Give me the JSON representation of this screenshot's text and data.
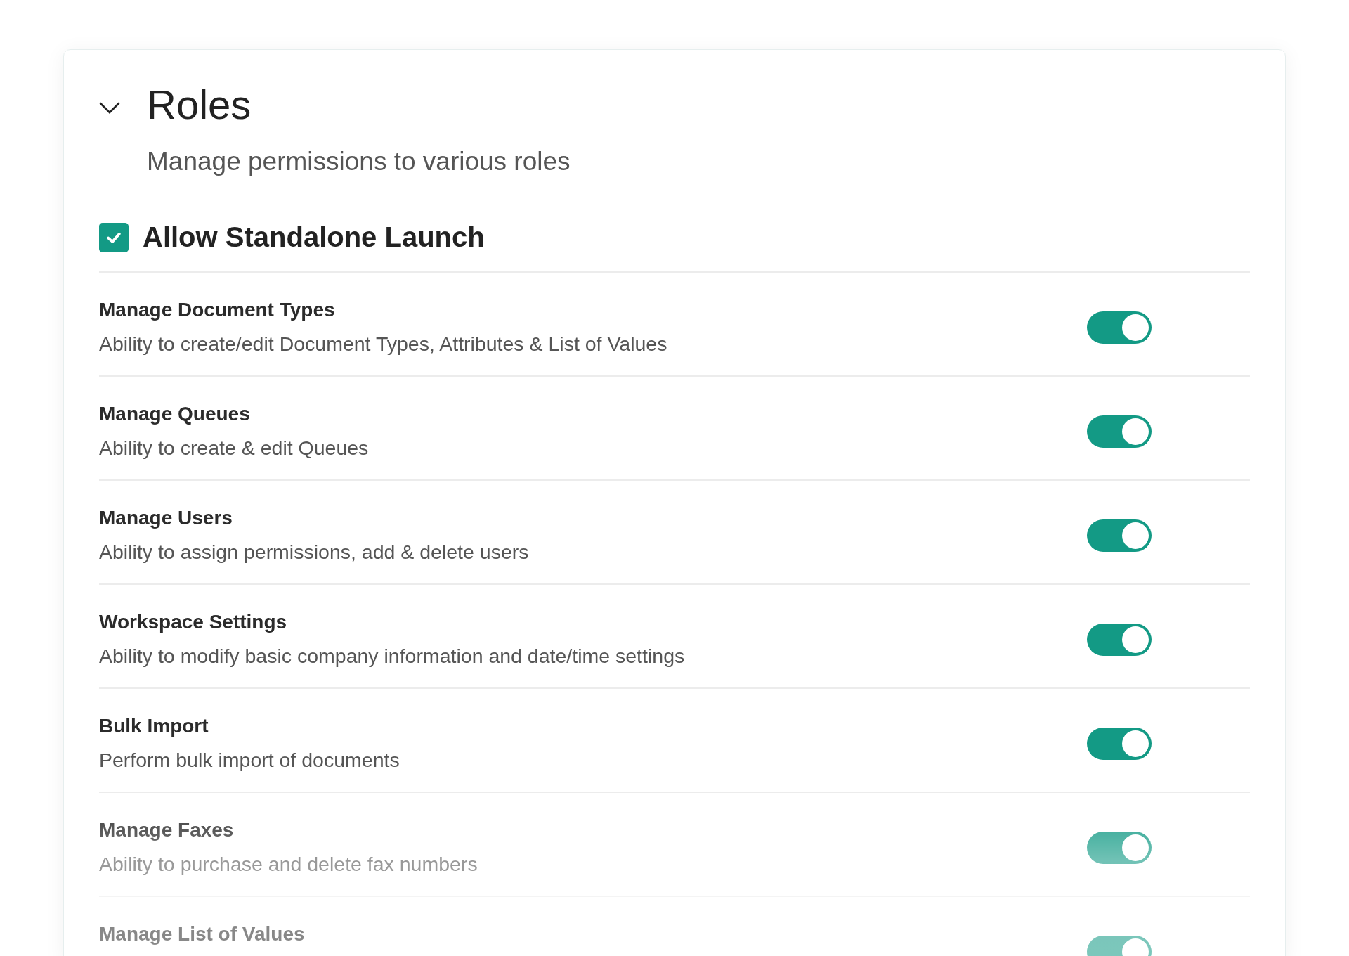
{
  "section": {
    "title": "Roles",
    "subtitle": "Manage permissions to various roles",
    "expanded": true
  },
  "standalone": {
    "label": "Allow Standalone Launch",
    "checked": true
  },
  "permissions": [
    {
      "title": "Manage Document Types",
      "description": "Ability to create/edit Document Types, Attributes & List of Values",
      "on": true
    },
    {
      "title": "Manage Queues",
      "description": "Ability to create & edit Queues",
      "on": true
    },
    {
      "title": "Manage Users",
      "description": "Ability to assign permissions, add & delete users",
      "on": true
    },
    {
      "title": "Workspace Settings",
      "description": "Ability to modify basic company information and date/time settings",
      "on": true
    },
    {
      "title": "Bulk Import",
      "description": "Perform bulk import of documents",
      "on": true
    },
    {
      "title": "Manage Faxes",
      "description": "Ability to purchase and delete fax numbers",
      "on": true
    },
    {
      "title": "Manage List of Values",
      "on": true
    }
  ]
}
